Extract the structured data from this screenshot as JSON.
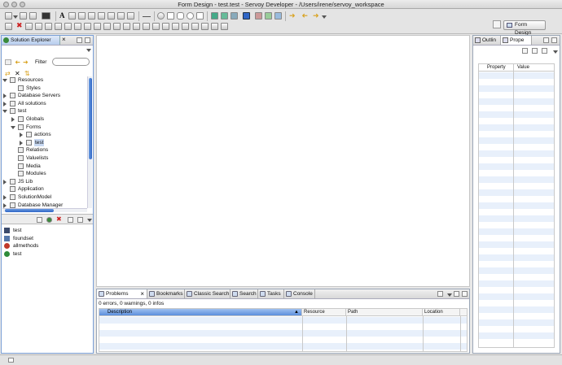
{
  "window": {
    "title": "Form Design - test.test - Servoy Developer - /Users/irene/servoy_workspace"
  },
  "perspective": {
    "label": "Form Design"
  },
  "solution_explorer": {
    "tab_label": "Solution Explorer",
    "filter_label": "Filter",
    "filter_value": "",
    "tree": [
      {
        "label": "Resources",
        "level": 0,
        "expanded": true,
        "icon": "folder-icon"
      },
      {
        "label": "Styles",
        "level": 1,
        "expanded": null,
        "icon": "styles-icon"
      },
      {
        "label": "Database Servers",
        "level": 0,
        "expanded": false,
        "icon": "database-servers-icon"
      },
      {
        "label": "All solutions",
        "level": 0,
        "expanded": false,
        "icon": "folder-icon"
      },
      {
        "label": "test",
        "level": 0,
        "expanded": true,
        "icon": "solution-icon"
      },
      {
        "label": "Globals",
        "level": 1,
        "expanded": false,
        "icon": "globals-icon"
      },
      {
        "label": "Forms",
        "level": 1,
        "expanded": true,
        "icon": "forms-icon"
      },
      {
        "label": "actions",
        "level": 2,
        "expanded": false,
        "icon": "form-icon"
      },
      {
        "label": "test",
        "level": 2,
        "expanded": false,
        "icon": "form-icon",
        "selected": true
      },
      {
        "label": "Relations",
        "level": 1,
        "expanded": null,
        "icon": "relations-icon"
      },
      {
        "label": "Valuelists",
        "level": 1,
        "expanded": null,
        "icon": "valuelists-icon"
      },
      {
        "label": "Media",
        "level": 1,
        "expanded": null,
        "icon": "media-icon"
      },
      {
        "label": "Modules",
        "level": 1,
        "expanded": null,
        "icon": "modules-icon"
      },
      {
        "label": "JS Lib",
        "level": 0,
        "expanded": false,
        "icon": "jslib-icon"
      },
      {
        "label": "Application",
        "level": 0,
        "expanded": null,
        "icon": "application-icon"
      },
      {
        "label": "SolutionModel",
        "level": 0,
        "expanded": false,
        "icon": "solutionmodel-icon"
      },
      {
        "label": "Database Manager",
        "level": 0,
        "expanded": false,
        "icon": "database-manager-icon"
      }
    ],
    "members": [
      {
        "label": "test",
        "icon": "form-icon",
        "color": "#3b4a6b"
      },
      {
        "label": "foundset",
        "icon": "foundset-icon",
        "color": "#5577aa"
      },
      {
        "label": "allmethods",
        "icon": "method-icon",
        "color": "#c0392b"
      },
      {
        "label": "test",
        "icon": "variable-icon",
        "color": "#2e8b3a"
      }
    ]
  },
  "right_panel": {
    "tabs": [
      {
        "label": "Outlin"
      },
      {
        "label": "Prope"
      }
    ],
    "columns": {
      "property": "Property",
      "value": "Value"
    }
  },
  "bottom_panel": {
    "tabs": [
      {
        "label": "Problems",
        "icon": "problems-icon"
      },
      {
        "label": "Bookmarks",
        "icon": "bookmarks-icon"
      },
      {
        "label": "Classic Search",
        "icon": "classic-search-icon"
      },
      {
        "label": "Search",
        "icon": "search-icon"
      },
      {
        "label": "Tasks",
        "icon": "tasks-icon"
      },
      {
        "label": "Console",
        "icon": "console-icon"
      }
    ],
    "summary": "0 errors, 0 warnings, 0 infos",
    "columns": {
      "description": "Description",
      "resource": "Resource",
      "path": "Path",
      "location": "Location"
    }
  },
  "colors": {
    "accent": "#2f66c6",
    "selection": "#c7d8f2",
    "stripe": "#e8f0fb"
  }
}
